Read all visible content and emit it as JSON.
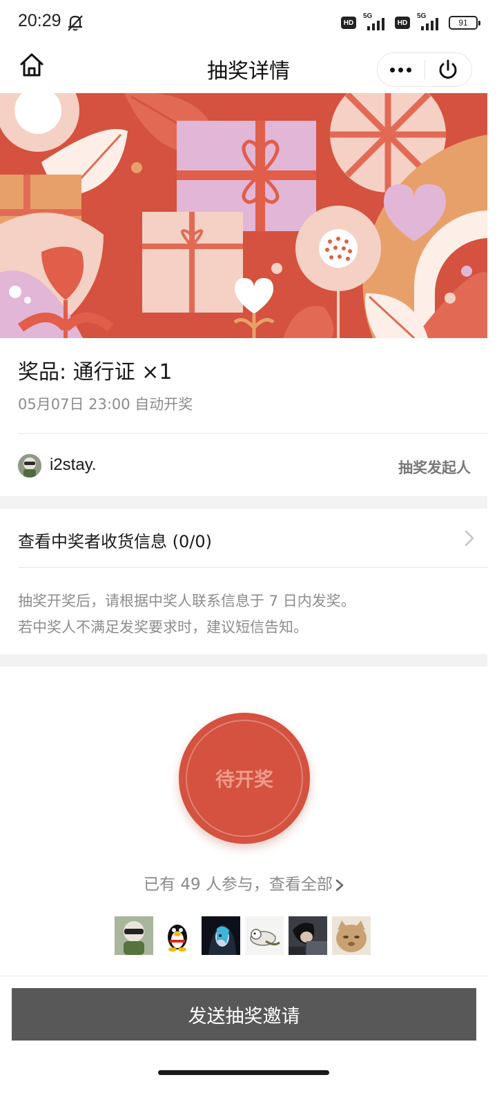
{
  "status_bar": {
    "time": "20:29",
    "signal_1_label": "5G",
    "signal_2_label": "5G",
    "hd_1": "HD",
    "hd_2": "HD",
    "battery": "91"
  },
  "nav": {
    "title": "抽奖详情"
  },
  "prize": {
    "title": "奖品: 通行证 ×1",
    "draw_time": "05月07日 23:00 自动开奖"
  },
  "host": {
    "name": "i2stay.",
    "role": "抽奖发起人"
  },
  "winner_info": {
    "label": "查看中奖者收货信息 (0/0)"
  },
  "notice": {
    "line1": "抽奖开奖后，请根据中奖人联系信息于 7 日内发奖。",
    "line2": "若中奖人不满足发奖要求时，建议短信告知。"
  },
  "draw_button": {
    "label": "待开奖"
  },
  "participants": {
    "text": "已有 49 人参与，查看全部"
  },
  "actions": {
    "send_invite": "发送抽奖邀请"
  },
  "colors": {
    "accent_red": "#d4523f",
    "send_button": "#585858"
  }
}
